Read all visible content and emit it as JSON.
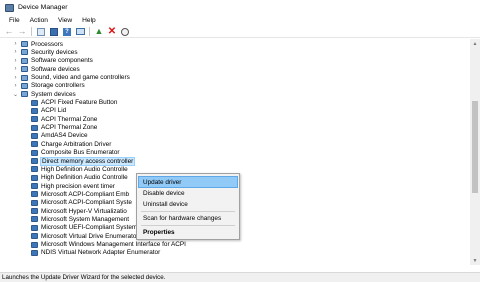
{
  "window": {
    "title": "Device Manager"
  },
  "menu": [
    "File",
    "Action",
    "View",
    "Help"
  ],
  "toolbar": {
    "icons": [
      "back-arrow-icon",
      "forward-arrow-icon",
      "properties-icon",
      "device-list-icon",
      "help-icon",
      "computer-icon",
      "update-driver-icon",
      "uninstall-icon",
      "scan-icon"
    ]
  },
  "tree": {
    "categories_before": [
      "Processors",
      "Security devices",
      "Software components",
      "Software devices",
      "Sound, video and game controllers",
      "Storage controllers"
    ],
    "expanded_category": "System devices",
    "devices": [
      "ACPI Fixed Feature Button",
      "ACPI Lid",
      "ACPI Thermal Zone",
      "ACPI Thermal Zone",
      "AmdAS4 Device",
      "Charge Arbitration Driver",
      "Composite Bus Enumerator",
      "Direct memory access controller",
      "High Definition Audio Controlle",
      "High Definition Audio Controlle",
      "High precision event timer",
      "Microsoft ACPI-Compliant Emb",
      "Microsoft ACPI-Compliant Syste",
      "Microsoft Hyper-V Virtualizatio",
      "Microsoft System Management",
      "Microsoft UEFI-Compliant System",
      "Microsoft Virtual Drive Enumerator",
      "Microsoft Windows Management Interface for ACPI",
      "NDIS Virtual Network Adapter Enumerator"
    ],
    "selected_device": "Direct memory access controller"
  },
  "context_menu": {
    "update_driver": "Update driver",
    "disable_device": "Disable device",
    "uninstall_device": "Uninstall device",
    "scan_hardware": "Scan for hardware changes",
    "properties": "Properties"
  },
  "status": {
    "text": "Launches the Update Driver Wizard for the selected device."
  },
  "colors": {
    "highlight": "#91c9f7",
    "selection": "#cce8ff",
    "icon": "#3d76b9"
  }
}
